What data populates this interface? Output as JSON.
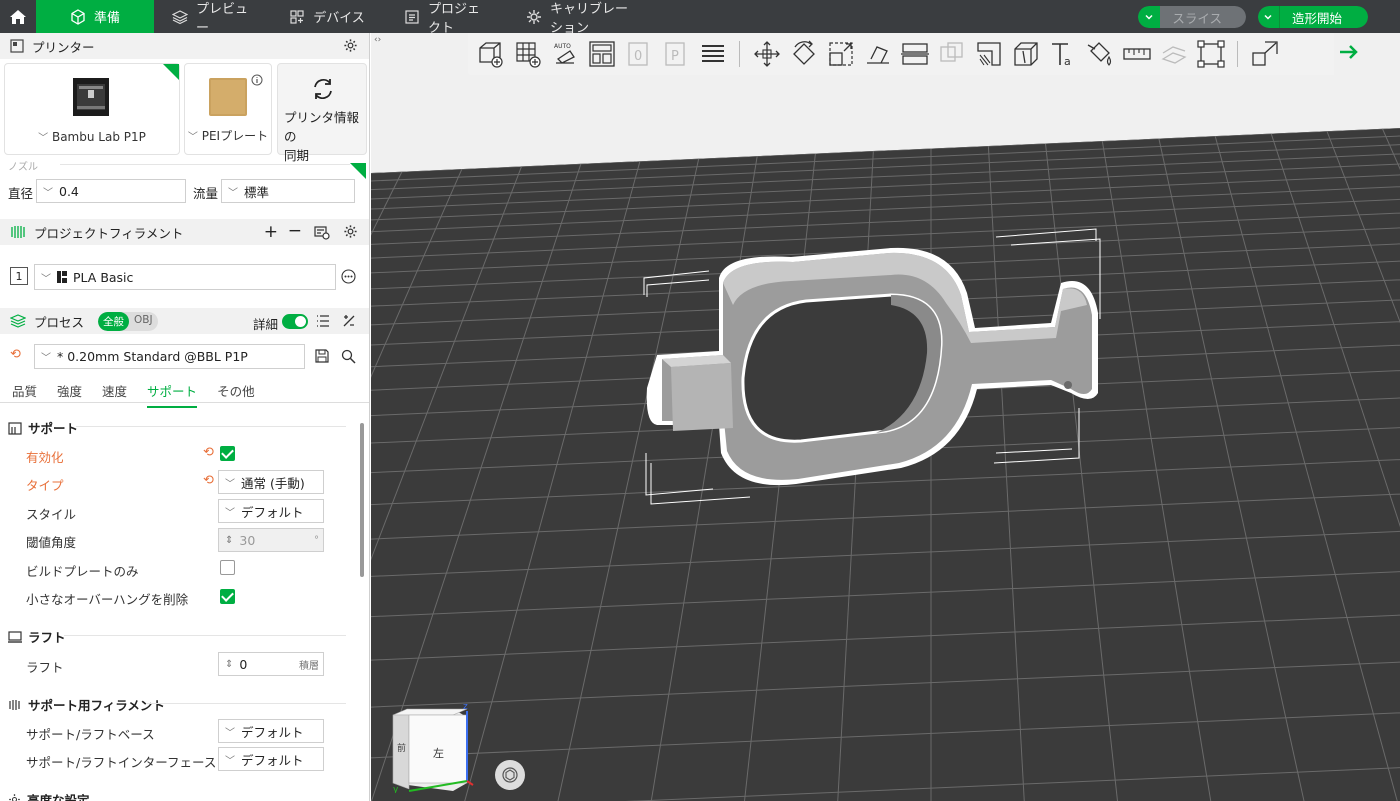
{
  "topbar": {
    "tabs": [
      {
        "label": "準備",
        "icon": "cube-icon",
        "active": true
      },
      {
        "label": "プレビュー",
        "icon": "layers-icon",
        "active": false
      },
      {
        "label": "デバイス",
        "icon": "device-icon",
        "active": false
      },
      {
        "label": "プロジェクト",
        "icon": "project-icon",
        "active": false
      },
      {
        "label": "キャリブレーション",
        "icon": "calibration-icon",
        "active": false
      }
    ],
    "slice_label": "スライス",
    "print_label": "造形開始"
  },
  "printer": {
    "section_title": "プリンター",
    "printer_name": "Bambu Lab P1P",
    "plate_name": "PEIプレート",
    "sync_label_1": "プリンタ情報の",
    "sync_label_2": "同期",
    "nozzle_title": "ノズル",
    "diameter_label": "直径",
    "diameter_value": "0.4",
    "flow_label": "流量",
    "flow_value": "標準"
  },
  "filament": {
    "section_title": "プロジェクトフィラメント",
    "slot": "1",
    "name": "PLA Basic"
  },
  "process": {
    "section_title": "プロセス",
    "toggle_global": "全般",
    "toggle_obj": "OBJ",
    "advanced_label": "詳細",
    "preset": "* 0.20mm Standard @BBL P1P",
    "tabs": [
      "品質",
      "強度",
      "速度",
      "サポート",
      "その他"
    ],
    "active_tab": "サポート"
  },
  "support": {
    "group_title": "サポート",
    "enable_label": "有効化",
    "type_label": "タイプ",
    "type_value": "通常 (手動)",
    "style_label": "スタイル",
    "style_value": "デフォルト",
    "threshold_label": "閾値角度",
    "threshold_value": "30",
    "threshold_unit": "°",
    "buildplate_label": "ビルドプレートのみ",
    "remove_small_label": "小さなオーバーハングを削除",
    "raft_group": "ラフト",
    "raft_label": "ラフト",
    "raft_value": "0",
    "raft_unit": "積層",
    "support_filament_group": "サポート用フィラメント",
    "base_label": "サポート/ラフトベース",
    "base_value": "デフォルト",
    "interface_label": "サポート/ラフトインターフェース",
    "interface_value": "デフォルト",
    "advanced_group": "高度な設定"
  },
  "viewcube": {
    "face_left": "左",
    "face_front": "前",
    "axis_z": "z",
    "axis_y": "y"
  },
  "colors": {
    "accent": "#00ae42",
    "topbar": "#3a3d40",
    "modified": "#e8703a",
    "bed": "#3b3b3b"
  }
}
